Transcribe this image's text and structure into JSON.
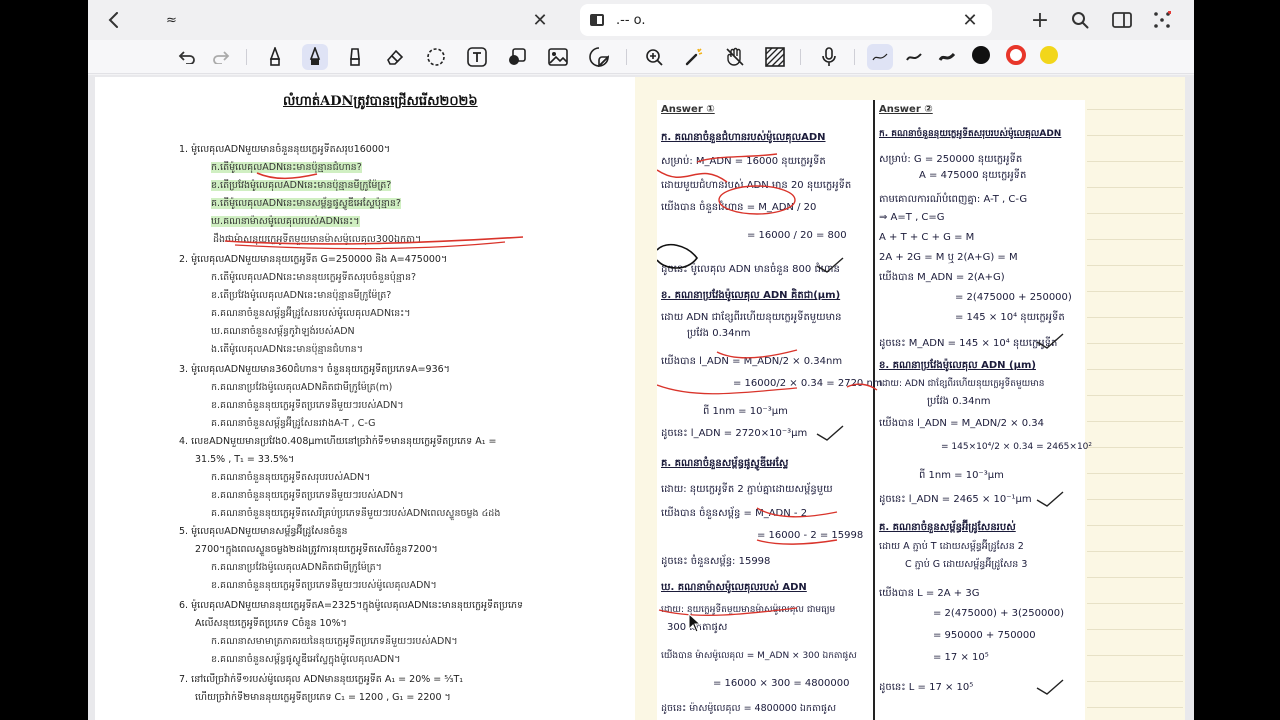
{
  "tabs": [
    {
      "title": "≈",
      "active": false
    },
    {
      "title": ".-- o.",
      "active": true
    }
  ],
  "toolbar": {
    "tools": [
      "undo-icon",
      "redo-icon",
      "pen-icon",
      "pen-selected-icon",
      "highlighter-icon",
      "eraser-icon",
      "lasso-icon",
      "text-icon",
      "shapes-icon",
      "image-icon",
      "sticker-icon",
      "zoom-icon",
      "laser-icon",
      "hand-icon",
      "hatch-icon",
      "mic-icon",
      "pen-thin-icon",
      "pen-medium-icon",
      "pen-thick-icon"
    ],
    "colors": [
      "#111111",
      "#e8362a",
      "#f2d61b"
    ]
  },
  "doc": {
    "title": "លំហាត់ADNត្រូវបាន​ជ្រើសរើស២០២៦",
    "questions": [
      "1.  ម៉ូលេគុលADNមួយមានចំនួននុយក្លេអូទីតសរុប16000។",
      "ក.តើម៉ូលេគុលADNនេះមានប៉ុន្មានជំហាន?",
      "ខ.តើប្រវែងម៉ូលេគុលADNនេះមានប៉ុន្មានមីក្រូម៉ែត្រ?",
      "គ.តើម៉ូលេគុលADNនេះមានសម្ព័ន្ធផូស្វូឌីអេស្ទែប៉ុន្មាន?",
      "ឃ.គណនាម៉ាសម៉ូលេគុលរបស់ADNនេះ។",
      "ដឹងថាម៉ាសនុយក្លេអូទីតមួយមានម៉ាសម៉ូលេគុល300ឯកតា។",
      "2.  ម៉ូលេគុលADNមួយមាននុយក្លេអូទីត G=250000 និង A=475000។",
      "ក.តើម៉ូលេគុលADNនេះមាននុយក្លេអូទីតសរុបចំនួនប៉ុន្មាន?",
      "ខ.តើប្រវែងម៉ូលេគុលADNនេះមានប៉ុន្មានមីក្រូម៉ែត្រ?",
      "គ.គណនាចំនួនសម្ព័ន្ធអ៊ីដ្រូសែនរបស់ម៉ូលេគុលADNនេះ។",
      "ឃ.គណនាចំនួនសម្ព័ន្ធកូវ៉ាឡង់របស់ADN",
      "ង.តើម៉ូលេគុលADNនេះមានប៉ុន្មានជំហាន។",
      "3.  ម៉ូលេគុលADNមួយមាន360ជំហាន។ ចំនួននុយក្លេអូទីតប្រភេទA=936។",
      "ក.គណនាប្រវែងម៉ូលេគុលADNគិតជាមីក្រូម៉ែត្រ(m)",
      "ខ.គណនាចំនួននុយក្លេអូទីតប្រភេទនីមួយៗរបស់ADN។",
      "គ.គណនាចំនួនសម្ព័ន្ធអ៊ីដ្រូសែនរវាងA-T , C-G",
      "4.  លេខADNមួយមានប្រវែង0.408µmហើយនៅច្រវ៉ាក់ទី១មាននុយក្លេអូទីតប្រភេទ A₁ =",
      "31.5%  , T₁ = 33.5%។",
      "ក.គណនាចំនួននុយក្លេអូទីតសរុបរបស់ADN។",
      "ខ.គណនាចំនួននុយក្លេអូទីតប្រភេទនីមួយៗរបស់ADN។",
      "គ.គណនាចំនួននុយក្លេអូទីតសេរីគ្រប់ប្រភេទនីមួយៗរបស់ADNពេលស្ទួនចម្លង ៤ដង",
      "5.  ម៉ូលេគុលADNមួយមានសម្ព័ន្ធអ៊ីដ្រូសែនចំនួន",
      "2700។ក្នុងពេលស្ទួនចម្លង២ដងត្រូវការនុយក្លេអូទីតសេរីចំនួន7200។",
      "ក.គណនាប្រវែងម៉ូលេគុលADNគិតជាមីក្រូម៉ែត្រ។",
      "ខ.គណនាចំនួននុយក្លេអូទីតប្រភេទនីមួយៗរបស់ម៉ូលេគុលADN។",
      "6.  ម៉ូលេគុលADNមួយមាននុយក្លេអូទីតA=2325។ក្នុងម៉ូលេគុលADNនេះមាននុយក្លេអូទីតប្រភេទ",
      "Aលើសនុយក្លេអូទីតប្រភេទ Cចំនួន 10%។",
      "ក.គណនាសមាមាត្រភាគរយនៃនុយក្លេអូទីតប្រភេទនីមួយៗរបស់ADN។",
      "ខ.គណនាចំនួនសម្ព័ន្ធផូស្វូឌីអេស្ទែក្នុងម៉ូលេគុលADN។",
      "7.  នៅលើច្រវ៉ាក់ទី១របស់ម៉ូលេគុល ADNមាននុយក្លេអូទីត A₁ = 20% = ⁵⁄₃T₁",
      "ហើយច្រវ៉ាក់ទី២មាននុយក្លេអូទីតប្រភេទ C₁ = 1200 , G₁ = 2200   ។"
    ]
  },
  "notes": {
    "answer1_label": "Answer ①",
    "answer2_label": "Answer ②",
    "col1": [
      "ក. គណនាចំនួនជំហានរបស់ម៉ូលេគុលADN",
      "សម្រាប់: M_ADN = 16000 នុយក្លេអូទីត",
      "ដោយមួយជំហានរបស់ ADN មាន 20 នុយក្លេអូទីត",
      "យើងបាន  ចំនួនជំហាន = M_ADN / 20",
      "= 16000 / 20 = 800",
      "ដូចនេះ ម៉ូលេគុល ADN មានចំនួន 800 ជំហាន",
      "ខ. គណនាប្រវែងម៉ូលេគុល ADN គិតជា(µm)",
      "ដោយ ADN ជាខ្សែពីរហើយនុយក្លេអូទីតមួយមាន",
      "ប្រវែង 0.34nm",
      "យើងបាន  l_ADN = M_ADN/2 × 0.34nm",
      "= 16000/2 × 0.34 = 2720 nm",
      "ពី 1nm = 10⁻³µm",
      "ដូចនេះ  l_ADN = 2720×10⁻³µm",
      "គ. គណនាចំនួនសម្ព័ន្ធផូស្វូឌីអេស្ទែ",
      "ដោយ: នុយក្លេអូទីត 2 ភ្ជាប់គ្នាដោយសម្ព័ន្ធមួយ",
      "យើងបាន  ចំនួនសម្ព័ន្ធ = M_ADN - 2",
      "= 16000 - 2 = 15998",
      "ដូចនេះ  ចំនួនសម្ព័ន្ធ: 15998",
      "ឃ. គណនាម៉ាសម៉ូលេគុលរបស់ ADN",
      "ដោយ: នុយក្លេអូទីតមួយមានម៉ាសម៉ូលេគុល ជាមធ្យម",
      "300 ឯកតាផូស",
      "យើងបាន  ម៉ាសម៉ូលេគុល = M_ADN × 300 ឯកតាផូស",
      "= 16000 × 300 = 4800000",
      "ដូចនេះ  ម៉ាសម៉ូលេគុល = 4800000 ឯកតាផូស"
    ],
    "col2": [
      "ក. គណនាចំនួននុយក្លេអូទីតសរុបរបស់ម៉ូលេគុលADN",
      "សម្រាប់:  G = 250000 នុយក្លេអូទីត",
      "A = 475000 នុយក្លេអូទីត",
      "តាមគោលការណ៍បំពេញគ្នា: A-T , C-G",
      "⇒ A=T , C=G",
      "A + T + C + G = M",
      "2A + 2G = M  ឬ  2(A+G) = M",
      "យើងបាន  M_ADN = 2(A+G)",
      "= 2(475000 + 250000)",
      "= 145 × 10⁴ នុយក្លេអូទីត",
      "ដូចនេះ  M_ADN = 145 × 10⁴ នុយក្លេអូទីត",
      "ខ. គណនាប្រវែងម៉ូលេគុល ADN (µm)",
      "ដោយ: ADN ជាខ្សែពីរហើយនុយក្លេអូទីតមួយមាន",
      "ប្រវែង 0.34nm",
      "យើងបាន  l_ADN = M_ADN/2 × 0.34",
      "= 145×10⁴/2 × 0.34 = 2465×10²",
      "ពី 1nm = 10⁻³µm",
      "ដូចនេះ  l_ADN = 2465 × 10⁻¹µm",
      "គ. គណនាចំនួនសម្ព័ន្ធអ៊ីដ្រូសែនរបស់",
      "ដោយ  A ភ្ជាប់ T ដោយសម្ព័ន្ធអ៊ីដ្រូសែន 2",
      "C ភ្ជាប់ G ដោយសម្ព័ន្ធអ៊ីដ្រូសែន 3",
      "យើងបាន  L = 2A + 3G",
      "= 2(475000) + 3(250000)",
      "= 950000 + 750000",
      "= 17 × 10⁵",
      "ដូចនេះ  L = 17 × 10⁵"
    ]
  }
}
